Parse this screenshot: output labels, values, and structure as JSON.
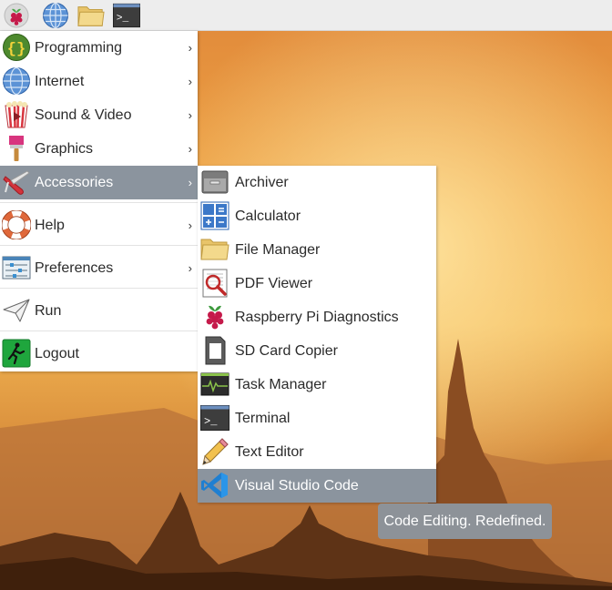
{
  "taskbar": {
    "items": [
      "raspberry-menu",
      "web-browser",
      "file-manager",
      "terminal"
    ],
    "terminal_glyph": ">_"
  },
  "main_menu": {
    "items": [
      {
        "label": "Programming",
        "icon": "programming-icon",
        "has_submenu": true
      },
      {
        "label": "Internet",
        "icon": "globe-icon",
        "has_submenu": true
      },
      {
        "label": "Sound & Video",
        "icon": "popcorn-icon",
        "has_submenu": true
      },
      {
        "label": "Graphics",
        "icon": "paintbrush-icon",
        "has_submenu": true
      },
      {
        "label": "Accessories",
        "icon": "swiss-knife-icon",
        "has_submenu": true,
        "active": true
      },
      {
        "label": "Help",
        "icon": "lifebuoy-icon",
        "has_submenu": true
      },
      {
        "label": "Preferences",
        "icon": "preferences-icon",
        "has_submenu": true
      },
      {
        "label": "Run",
        "icon": "paper-plane-icon",
        "has_submenu": false
      },
      {
        "label": "Logout",
        "icon": "exit-icon",
        "has_submenu": false
      }
    ],
    "arrow": "›"
  },
  "accessories_menu": {
    "items": [
      {
        "label": "Archiver",
        "icon": "archiver-icon"
      },
      {
        "label": "Calculator",
        "icon": "calculator-icon"
      },
      {
        "label": "File Manager",
        "icon": "folder-icon"
      },
      {
        "label": "PDF Viewer",
        "icon": "pdf-viewer-icon"
      },
      {
        "label": "Raspberry Pi Diagnostics",
        "icon": "raspberry-icon"
      },
      {
        "label": "SD Card Copier",
        "icon": "sd-card-icon"
      },
      {
        "label": "Task Manager",
        "icon": "task-manager-icon"
      },
      {
        "label": "Terminal",
        "icon": "terminal-icon"
      },
      {
        "label": "Text Editor",
        "icon": "pencil-icon"
      },
      {
        "label": "Visual Studio Code",
        "icon": "vscode-icon",
        "active": true
      }
    ]
  },
  "tooltip": {
    "text": "Code Editing. Redefined."
  },
  "colors": {
    "highlight": "#8b949e",
    "menu_bg": "#ffffff",
    "taskbar_bg": "#ededed"
  }
}
